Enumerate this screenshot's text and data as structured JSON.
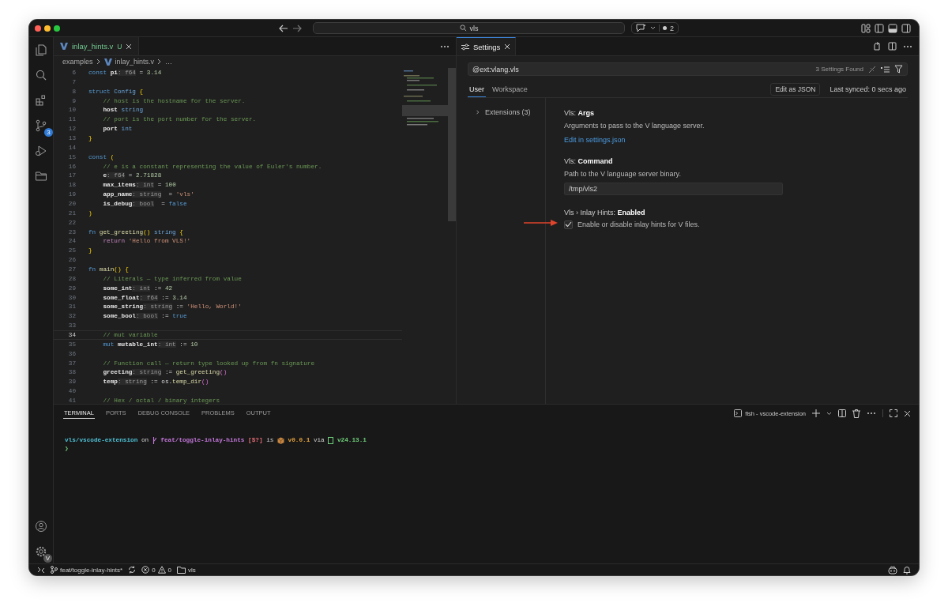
{
  "title_bar": {
    "search": "vls",
    "chat_count": "2"
  },
  "activity_bar": {
    "source_control_badge": "3",
    "account_badge": "V"
  },
  "editor": {
    "tab": {
      "name": "inlay_hints.v",
      "status": "U"
    },
    "breadcrumb": [
      "examples",
      "inlay_hints.v",
      "…"
    ],
    "lines": [
      {
        "num": "6",
        "current": false,
        "tokens": [
          {
            "kind": "kw",
            "t": "const "
          },
          {
            "kind": "name",
            "t": "pi"
          },
          {
            "kind": "hint",
            "t": ": f64"
          },
          {
            "kind": "plain",
            "t": " = "
          },
          {
            "kind": "num",
            "t": "3.14"
          }
        ]
      },
      {
        "num": "7",
        "current": false
      },
      {
        "num": "8",
        "current": false,
        "tokens": [
          {
            "kind": "kw",
            "t": "struct "
          },
          {
            "kind": "type",
            "t": "Config"
          },
          {
            "kind": "brace",
            "t": " {"
          }
        ]
      },
      {
        "num": "9",
        "current": false,
        "tokens": [
          {
            "kind": "cmt",
            "t": "    // host is the hostname for the server."
          }
        ]
      },
      {
        "num": "10",
        "current": false,
        "tokens": [
          {
            "kind": "name",
            "t": "    host"
          },
          {
            "kind": "type",
            "t": " string"
          }
        ]
      },
      {
        "num": "11",
        "current": false,
        "tokens": [
          {
            "kind": "cmt",
            "t": "    // port is the port number for the server."
          }
        ]
      },
      {
        "num": "12",
        "current": false,
        "tokens": [
          {
            "kind": "name",
            "t": "    port"
          },
          {
            "kind": "type",
            "t": " int"
          }
        ]
      },
      {
        "num": "13",
        "current": false,
        "tokens": [
          {
            "kind": "brace",
            "t": "}"
          }
        ]
      },
      {
        "num": "14",
        "current": false
      },
      {
        "num": "15",
        "current": false,
        "tokens": [
          {
            "kind": "kw",
            "t": "const "
          },
          {
            "kind": "brace",
            "t": "("
          }
        ]
      },
      {
        "num": "16",
        "current": false,
        "tokens": [
          {
            "kind": "cmt",
            "t": "    // e is a constant representing the value of Euler's number."
          }
        ]
      },
      {
        "num": "17",
        "current": false,
        "tokens": [
          {
            "kind": "name",
            "t": "    e"
          },
          {
            "kind": "hint",
            "t": ": f64"
          },
          {
            "kind": "plain",
            "t": " = "
          },
          {
            "kind": "num",
            "t": "2.71828"
          }
        ]
      },
      {
        "num": "18",
        "current": false,
        "tokens": [
          {
            "kind": "name",
            "t": "    max_items"
          },
          {
            "kind": "hint",
            "t": ": int"
          },
          {
            "kind": "plain",
            "t": " = "
          },
          {
            "kind": "num",
            "t": "100"
          }
        ]
      },
      {
        "num": "19",
        "current": false,
        "tokens": [
          {
            "kind": "name",
            "t": "    app_name"
          },
          {
            "kind": "hint",
            "t": ": string"
          },
          {
            "kind": "plain",
            "t": "  = "
          },
          {
            "kind": "str",
            "t": "'vls'"
          }
        ]
      },
      {
        "num": "20",
        "current": false,
        "tokens": [
          {
            "kind": "name",
            "t": "    is_debug"
          },
          {
            "kind": "hint",
            "t": ": bool"
          },
          {
            "kind": "plain",
            "t": "  = "
          },
          {
            "kind": "kw",
            "t": "false"
          }
        ]
      },
      {
        "num": "21",
        "current": false,
        "tokens": [
          {
            "kind": "brace",
            "t": ")"
          }
        ]
      },
      {
        "num": "22",
        "current": false
      },
      {
        "num": "23",
        "current": false,
        "tokens": [
          {
            "kind": "kw",
            "t": "fn "
          },
          {
            "kind": "fn",
            "t": "get_greeting"
          },
          {
            "kind": "brace",
            "t": "()"
          },
          {
            "kind": "type",
            "t": " string"
          },
          {
            "kind": "brace",
            "t": " {"
          }
        ]
      },
      {
        "num": "24",
        "current": false,
        "tokens": [
          {
            "kind": "ctrl",
            "t": "    return "
          },
          {
            "kind": "str",
            "t": "'Hello from VLS!'"
          }
        ]
      },
      {
        "num": "25",
        "current": false,
        "tokens": [
          {
            "kind": "brace",
            "t": "}"
          }
        ]
      },
      {
        "num": "26",
        "current": false
      },
      {
        "num": "27",
        "current": false,
        "tokens": [
          {
            "kind": "kw",
            "t": "fn "
          },
          {
            "kind": "fn",
            "t": "main"
          },
          {
            "kind": "brace",
            "t": "() {"
          }
        ]
      },
      {
        "num": "28",
        "current": false,
        "tokens": [
          {
            "kind": "cmt",
            "t": "    // Literals — type inferred from value"
          }
        ]
      },
      {
        "num": "29",
        "current": false,
        "tokens": [
          {
            "kind": "name",
            "t": "    some_int"
          },
          {
            "kind": "hint",
            "t": ": int"
          },
          {
            "kind": "plain",
            "t": " := "
          },
          {
            "kind": "num",
            "t": "42"
          }
        ]
      },
      {
        "num": "30",
        "current": false,
        "tokens": [
          {
            "kind": "name",
            "t": "    some_float"
          },
          {
            "kind": "hint",
            "t": ": f64"
          },
          {
            "kind": "plain",
            "t": " := "
          },
          {
            "kind": "num",
            "t": "3.14"
          }
        ]
      },
      {
        "num": "31",
        "current": false,
        "tokens": [
          {
            "kind": "name",
            "t": "    some_string"
          },
          {
            "kind": "hint",
            "t": ": string"
          },
          {
            "kind": "plain",
            "t": " := "
          },
          {
            "kind": "str",
            "t": "'Hello, World!'"
          }
        ]
      },
      {
        "num": "32",
        "current": false,
        "tokens": [
          {
            "kind": "name",
            "t": "    some_bool"
          },
          {
            "kind": "hint",
            "t": ": bool"
          },
          {
            "kind": "plain",
            "t": " := "
          },
          {
            "kind": "kw",
            "t": "true"
          }
        ]
      },
      {
        "num": "33",
        "current": false
      },
      {
        "num": "34",
        "current": true,
        "tokens": [
          {
            "kind": "cmt",
            "t": "    // mut variable"
          }
        ]
      },
      {
        "num": "35",
        "current": false,
        "tokens": [
          {
            "kind": "kw",
            "t": "    mut "
          },
          {
            "kind": "name",
            "t": "mutable_int"
          },
          {
            "kind": "hint",
            "t": ": int"
          },
          {
            "kind": "plain",
            "t": " := "
          },
          {
            "kind": "num",
            "t": "10"
          }
        ]
      },
      {
        "num": "36",
        "current": false
      },
      {
        "num": "37",
        "current": false,
        "tokens": [
          {
            "kind": "cmt",
            "t": "    // Function call — return type looked up from fn signature"
          }
        ]
      },
      {
        "num": "38",
        "current": false,
        "tokens": [
          {
            "kind": "name",
            "t": "    greeting"
          },
          {
            "kind": "hint",
            "t": ": string"
          },
          {
            "kind": "plain",
            "t": " := "
          },
          {
            "kind": "fn",
            "t": "get_greeting"
          },
          {
            "kind": "paren",
            "t": "()"
          }
        ]
      },
      {
        "num": "39",
        "current": false,
        "tokens": [
          {
            "kind": "name",
            "t": "    temp"
          },
          {
            "kind": "hint",
            "t": ": string"
          },
          {
            "kind": "plain",
            "t": " := os."
          },
          {
            "kind": "fn",
            "t": "temp_dir"
          },
          {
            "kind": "paren",
            "t": "()"
          }
        ]
      },
      {
        "num": "40",
        "current": false
      },
      {
        "num": "41",
        "current": false,
        "tokens": [
          {
            "kind": "cmt",
            "t": "    // Hex / octal / binary integers"
          }
        ]
      }
    ]
  },
  "settings": {
    "tab": "Settings",
    "search": "@ext:vlang.vls",
    "found": "3 Settings Found",
    "scopes": [
      {
        "label": "User",
        "selected": true
      },
      {
        "label": "Workspace",
        "selected": false
      }
    ],
    "edit_json": "Edit as JSON",
    "last_synced": "Last synced: 0 secs ago",
    "toc": [
      {
        "label": "Extensions (3)",
        "expanded": false
      }
    ],
    "items": [
      {
        "kind": "link",
        "title": "Vls: **Args**",
        "description": "Arguments to pass to the V language server.",
        "link": "Edit in settings.json",
        "annotated": false
      },
      {
        "kind": "text",
        "title": "Vls: **Command**",
        "description": "Path to the V language server binary.",
        "value": "/tmp/vls2",
        "annotated": false
      },
      {
        "kind": "checkbox",
        "title": "Vls › Inlay Hints: **Enabled**",
        "description": "Enable or disable inlay hints for V files.",
        "checked": true,
        "annotated": true
      }
    ]
  },
  "panel": {
    "tabs": [
      {
        "label": "TERMINAL",
        "selected": true
      },
      {
        "label": "PORTS",
        "selected": false
      },
      {
        "label": "DEBUG CONSOLE",
        "selected": false
      },
      {
        "label": "PROBLEMS",
        "selected": false
      },
      {
        "label": "OUTPUT",
        "selected": false
      }
    ],
    "terminal_name": "fish - vscode-extension",
    "prompt_line": [
      {
        "kind": "text",
        "text": "vls/vscode-extension",
        "color": "#4fc3d8"
      },
      {
        "kind": "plain",
        "text": " on "
      },
      {
        "kind": "branch"
      },
      {
        "kind": "text",
        "text": " feat/toggle-inlay-hints",
        "color": "#c678dd"
      },
      {
        "kind": "text",
        "text": " [$?]",
        "color": "#e06c75"
      },
      {
        "kind": "plain",
        "text": " is "
      },
      {
        "kind": "package"
      },
      {
        "kind": "text",
        "text": " v0.0.1",
        "color": "#e5a33d"
      },
      {
        "kind": "plain",
        "text": " via "
      },
      {
        "kind": "node"
      },
      {
        "kind": "text",
        "text": " v24.13.1",
        "color": "#6fcf7a"
      }
    ],
    "cursor": "❯"
  },
  "status_bar": {
    "branch": "feat/toggle-inlay-hints*",
    "errors": "0",
    "warnings": "0",
    "folder": "vls"
  }
}
